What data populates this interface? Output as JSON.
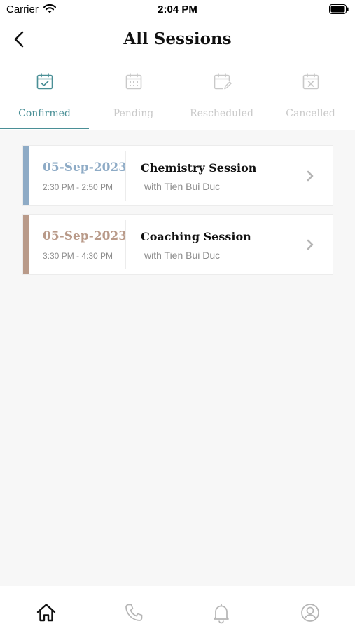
{
  "status_bar": {
    "carrier": "Carrier",
    "time": "2:04 PM"
  },
  "header": {
    "title": "All Sessions"
  },
  "tabs": [
    {
      "label": "Confirmed",
      "icon": "calendar-check-icon",
      "active": true
    },
    {
      "label": "Pending",
      "icon": "calendar-grid-icon",
      "active": false
    },
    {
      "label": "Rescheduled",
      "icon": "calendar-edit-icon",
      "active": false
    },
    {
      "label": "Cancelled",
      "icon": "calendar-x-icon",
      "active": false
    }
  ],
  "sessions": [
    {
      "date": "05-Sep-2023",
      "time": "2:30 PM - 2:50 PM",
      "name": "Chemistry Session",
      "with": "with Tien Bui Duc",
      "accent": "#8eabc6"
    },
    {
      "date": "05-Sep-2023",
      "time": "3:30 PM - 4:30 PM",
      "name": "Coaching Session",
      "with": "with Tien Bui Duc",
      "accent": "#b99a89"
    }
  ],
  "bottom_nav": [
    {
      "icon": "home-icon",
      "active": true
    },
    {
      "icon": "phone-icon",
      "active": false
    },
    {
      "icon": "bell-icon",
      "active": false
    },
    {
      "icon": "profile-icon",
      "active": false
    }
  ],
  "colors": {
    "active": "#4a8f96",
    "inactive": "#c9c9c9",
    "nav_active": "#111111",
    "nav_inactive": "#b5b5b5"
  }
}
